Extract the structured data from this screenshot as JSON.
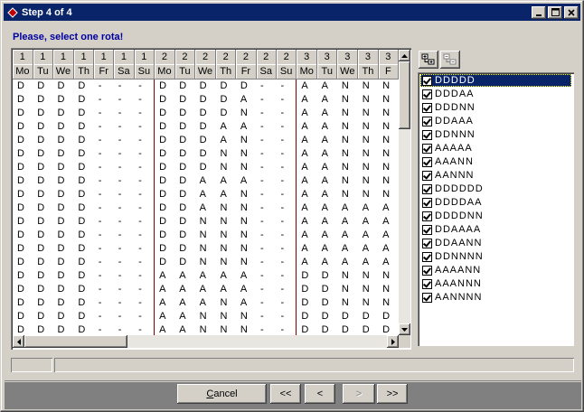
{
  "window": {
    "title": "Step 4 of 4",
    "minimize": "_",
    "maximize": "□",
    "close": "✕"
  },
  "prompt": "Please, select one rota!",
  "grid": {
    "headers_top": [
      "1",
      "1",
      "1",
      "1",
      "1",
      "1",
      "1",
      "2",
      "2",
      "2",
      "2",
      "2",
      "2",
      "2",
      "3",
      "3",
      "3",
      "3",
      "3"
    ],
    "headers_day": [
      "Mo",
      "Tu",
      "We",
      "Th",
      "Fr",
      "Sa",
      "Su",
      "Mo",
      "Tu",
      "We",
      "Th",
      "Fr",
      "Sa",
      "Su",
      "Mo",
      "Tu",
      "We",
      "Th",
      "F"
    ],
    "rows": [
      [
        "D",
        "D",
        "D",
        "D",
        "-",
        "-",
        "-",
        "D",
        "D",
        "D",
        "D",
        "D",
        "-",
        "-",
        "A",
        "A",
        "N",
        "N",
        "N"
      ],
      [
        "D",
        "D",
        "D",
        "D",
        "-",
        "-",
        "-",
        "D",
        "D",
        "D",
        "D",
        "A",
        "-",
        "-",
        "A",
        "A",
        "N",
        "N",
        "N"
      ],
      [
        "D",
        "D",
        "D",
        "D",
        "-",
        "-",
        "-",
        "D",
        "D",
        "D",
        "D",
        "N",
        "-",
        "-",
        "A",
        "A",
        "N",
        "N",
        "N"
      ],
      [
        "D",
        "D",
        "D",
        "D",
        "-",
        "-",
        "-",
        "D",
        "D",
        "D",
        "A",
        "A",
        "-",
        "-",
        "A",
        "A",
        "N",
        "N",
        "N"
      ],
      [
        "D",
        "D",
        "D",
        "D",
        "-",
        "-",
        "-",
        "D",
        "D",
        "D",
        "A",
        "N",
        "-",
        "-",
        "A",
        "A",
        "N",
        "N",
        "N"
      ],
      [
        "D",
        "D",
        "D",
        "D",
        "-",
        "-",
        "-",
        "D",
        "D",
        "D",
        "N",
        "N",
        "-",
        "-",
        "A",
        "A",
        "N",
        "N",
        "N"
      ],
      [
        "D",
        "D",
        "D",
        "D",
        "-",
        "-",
        "-",
        "D",
        "D",
        "D",
        "N",
        "N",
        "-",
        "-",
        "A",
        "A",
        "N",
        "N",
        "N"
      ],
      [
        "D",
        "D",
        "D",
        "D",
        "-",
        "-",
        "-",
        "D",
        "D",
        "A",
        "A",
        "A",
        "-",
        "-",
        "A",
        "A",
        "N",
        "N",
        "N"
      ],
      [
        "D",
        "D",
        "D",
        "D",
        "-",
        "-",
        "-",
        "D",
        "D",
        "A",
        "A",
        "N",
        "-",
        "-",
        "A",
        "A",
        "N",
        "N",
        "N"
      ],
      [
        "D",
        "D",
        "D",
        "D",
        "-",
        "-",
        "-",
        "D",
        "D",
        "A",
        "N",
        "N",
        "-",
        "-",
        "A",
        "A",
        "A",
        "A",
        "A"
      ],
      [
        "D",
        "D",
        "D",
        "D",
        "-",
        "-",
        "-",
        "D",
        "D",
        "N",
        "N",
        "N",
        "-",
        "-",
        "A",
        "A",
        "A",
        "A",
        "A"
      ],
      [
        "D",
        "D",
        "D",
        "D",
        "-",
        "-",
        "-",
        "D",
        "D",
        "N",
        "N",
        "N",
        "-",
        "-",
        "A",
        "A",
        "A",
        "A",
        "A"
      ],
      [
        "D",
        "D",
        "D",
        "D",
        "-",
        "-",
        "-",
        "D",
        "D",
        "N",
        "N",
        "N",
        "-",
        "-",
        "A",
        "A",
        "A",
        "A",
        "A"
      ],
      [
        "D",
        "D",
        "D",
        "D",
        "-",
        "-",
        "-",
        "D",
        "D",
        "N",
        "N",
        "N",
        "-",
        "-",
        "A",
        "A",
        "A",
        "A",
        "A"
      ],
      [
        "D",
        "D",
        "D",
        "D",
        "-",
        "-",
        "-",
        "A",
        "A",
        "A",
        "A",
        "A",
        "-",
        "-",
        "D",
        "D",
        "N",
        "N",
        "N"
      ],
      [
        "D",
        "D",
        "D",
        "D",
        "-",
        "-",
        "-",
        "A",
        "A",
        "A",
        "A",
        "A",
        "-",
        "-",
        "D",
        "D",
        "N",
        "N",
        "N"
      ],
      [
        "D",
        "D",
        "D",
        "D",
        "-",
        "-",
        "-",
        "A",
        "A",
        "A",
        "N",
        "A",
        "-",
        "-",
        "D",
        "D",
        "N",
        "N",
        "N"
      ],
      [
        "D",
        "D",
        "D",
        "D",
        "-",
        "-",
        "-",
        "A",
        "A",
        "N",
        "N",
        "N",
        "-",
        "-",
        "D",
        "D",
        "D",
        "D",
        "D"
      ],
      [
        "D",
        "D",
        "D",
        "D",
        "-",
        "-",
        "-",
        "A",
        "A",
        "N",
        "N",
        "N",
        "-",
        "-",
        "D",
        "D",
        "D",
        "D",
        "D"
      ]
    ]
  },
  "rota_list": [
    {
      "label": "DDDDD",
      "checked": true,
      "selected": true
    },
    {
      "label": "DDDAA",
      "checked": true,
      "selected": false
    },
    {
      "label": "DDDNN",
      "checked": true,
      "selected": false
    },
    {
      "label": "DDAAA",
      "checked": true,
      "selected": false
    },
    {
      "label": "DDNNN",
      "checked": true,
      "selected": false
    },
    {
      "label": "AAAAA",
      "checked": true,
      "selected": false
    },
    {
      "label": "AAANN",
      "checked": true,
      "selected": false
    },
    {
      "label": "AANNN",
      "checked": true,
      "selected": false
    },
    {
      "label": "DDDDDD",
      "checked": true,
      "selected": false
    },
    {
      "label": "DDDDAA",
      "checked": true,
      "selected": false
    },
    {
      "label": "DDDDNN",
      "checked": true,
      "selected": false
    },
    {
      "label": "DDAAAA",
      "checked": true,
      "selected": false
    },
    {
      "label": "DDAANN",
      "checked": true,
      "selected": false
    },
    {
      "label": "DDNNNN",
      "checked": true,
      "selected": false
    },
    {
      "label": "AAAANN",
      "checked": true,
      "selected": false
    },
    {
      "label": "AAANNN",
      "checked": true,
      "selected": false
    },
    {
      "label": "AANNNN",
      "checked": true,
      "selected": false
    }
  ],
  "buttons": {
    "cancel": "Cancel",
    "first": "<<",
    "prev": "<",
    "next": ">",
    "last": ">>"
  },
  "colors": {
    "title_bar": "#0a246a",
    "prompt": "#0000a0",
    "week_separator": "#800000"
  }
}
